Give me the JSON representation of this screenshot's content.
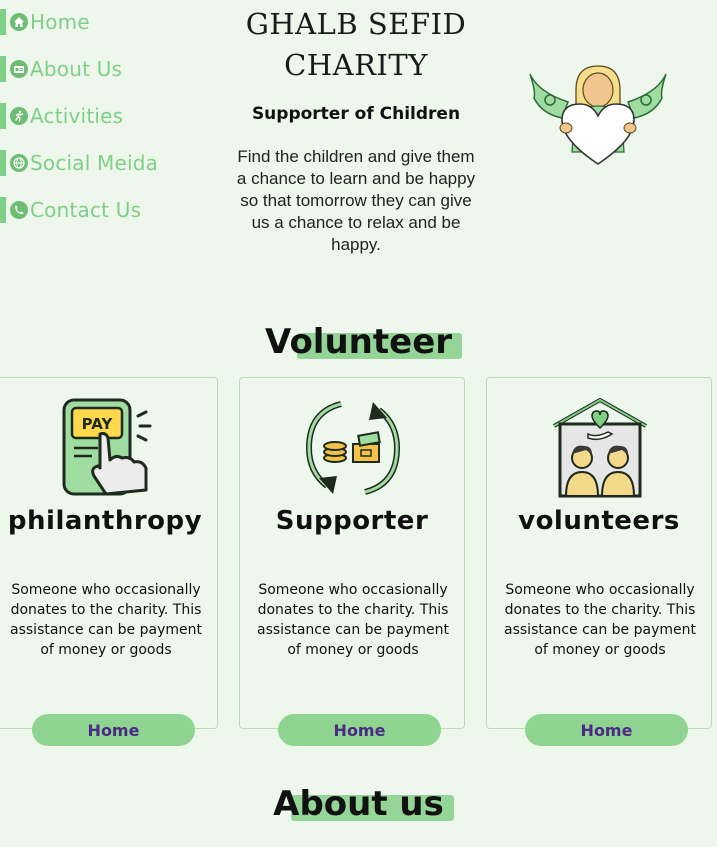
{
  "nav": {
    "items": [
      {
        "label": "Home",
        "icon": "home-icon"
      },
      {
        "label": "About Us",
        "icon": "id-card-icon"
      },
      {
        "label": "Activities",
        "icon": "running-icon"
      },
      {
        "label": "Social Meida",
        "icon": "globe-icon"
      },
      {
        "label": "Contact Us",
        "icon": "phone-icon"
      }
    ]
  },
  "hero": {
    "brand": "GHALB SEFID CHARITY",
    "tagline": "Supporter of Children",
    "description": "Find the children and give them a chance to learn and be happy so that tomorrow they can give us a chance to relax and be happy."
  },
  "volunteer": {
    "title_first": "V",
    "title_rest": "olunteer",
    "cards": [
      {
        "title": "philanthropy",
        "body": "Someone who occasionally donates to the charity. This assistance can be payment of money or goods",
        "button": "Home",
        "icon": "pay-tap-icon"
      },
      {
        "title": "Supporter",
        "body": "Someone who occasionally donates to the charity. This assistance can be payment of money or goods",
        "button": "Home",
        "icon": "money-exchange-icon"
      },
      {
        "title": "volunteers",
        "body": "Someone who occasionally donates to the charity. This assistance can be payment of money or goods",
        "button": "Home",
        "icon": "people-house-icon"
      }
    ]
  },
  "about": {
    "title_first": "A",
    "title_rest": "bout us"
  },
  "colors": {
    "accent": "#7fcf86",
    "button": "#8fd591",
    "button_text": "#4b2a86",
    "background": "#edf7ec"
  }
}
